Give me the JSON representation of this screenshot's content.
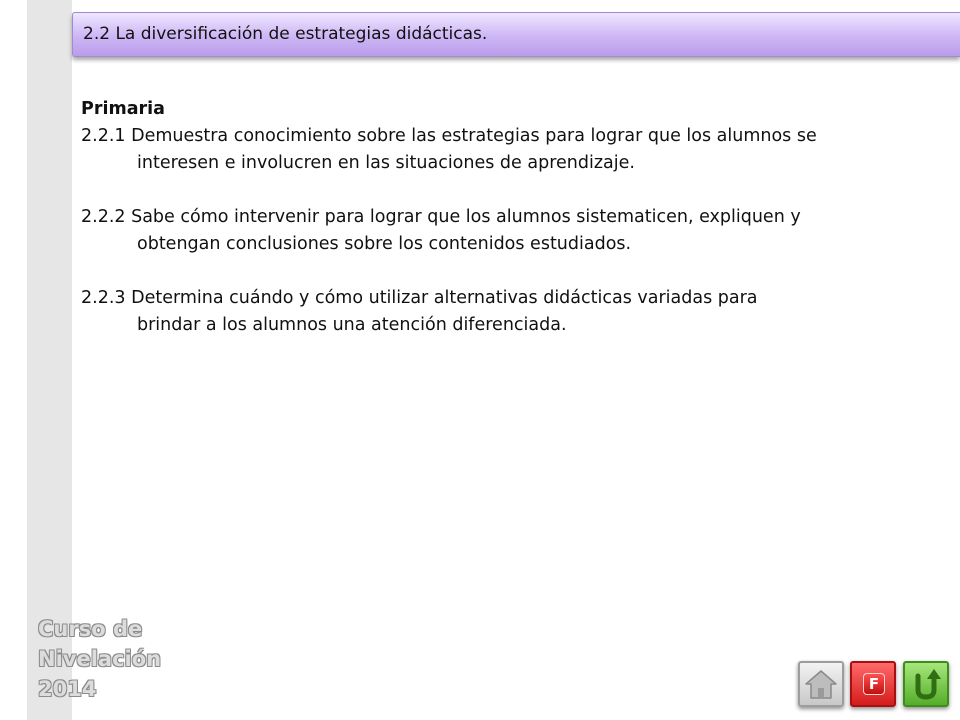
{
  "header": {
    "title": "2.2 La diversificación de estrategias didácticas."
  },
  "content": {
    "heading": "Primaria",
    "items": [
      {
        "line1": "2.2.1 Demuestra conocimiento sobre las estrategias para lograr que los alumnos se",
        "line2": "interesen e involucren en las situaciones de aprendizaje."
      },
      {
        "line1": "2.2.2 Sabe cómo intervenir para lograr que los alumnos sistematicen, expliquen y",
        "line2": "obtengan conclusiones sobre los contenidos estudiados."
      },
      {
        "line1": "2.2.3 Determina cuándo y cómo utilizar alternativas didácticas variadas para",
        "line2": "brindar a los alumnos una atención diferenciada."
      }
    ]
  },
  "branding": {
    "line1": "Curso de",
    "line2": "Nivelación",
    "line3": "2014"
  },
  "nav": {
    "home_icon": "home-icon",
    "f_label": "F",
    "return_icon": "u-turn-icon"
  },
  "colors": {
    "title_bar": "#cdb6f5",
    "side_strip": "#e6e6e6",
    "home_button": "#c8c8c8",
    "f_button": "#d41c1c",
    "return_button": "#55ad2a"
  }
}
